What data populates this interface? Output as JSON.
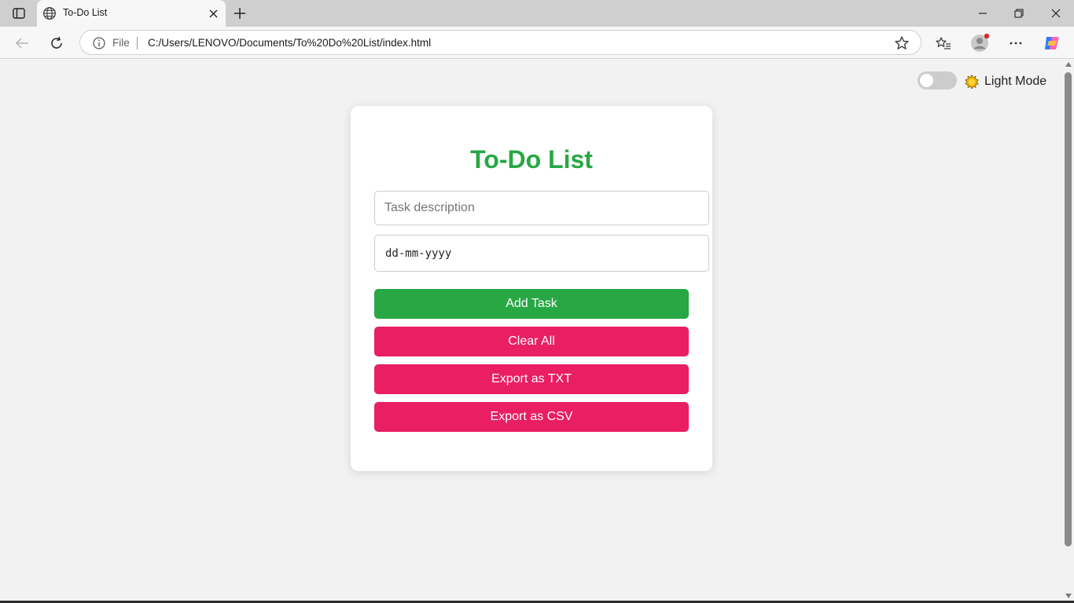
{
  "browser": {
    "tab_title": "To-Do List",
    "address_scheme": "File",
    "address_url": "C:/Users/LENOVO/Documents/To%20Do%20List/index.html"
  },
  "page": {
    "theme_label": "Light Mode",
    "theme_dark": false,
    "title": "To-Do List",
    "task_placeholder": "Task description",
    "date_value": "dd-mm-yyyy",
    "buttons": {
      "add": "Add Task",
      "clear": "Clear All",
      "export_txt": "Export as TXT",
      "export_csv": "Export as CSV"
    }
  },
  "colors": {
    "accent_green": "#28a745",
    "accent_pink": "#e91e63",
    "page_bg": "#f2f2f2"
  },
  "icons": [
    "tab-actions-icon",
    "globe-icon",
    "close-icon",
    "plus-icon",
    "minimize-icon",
    "restore-icon",
    "window-close-icon",
    "back-arrow-icon",
    "refresh-icon",
    "info-icon",
    "star-icon",
    "favorites-icon",
    "profile-icon",
    "more-icon",
    "copilot-icon",
    "sun-icon"
  ]
}
